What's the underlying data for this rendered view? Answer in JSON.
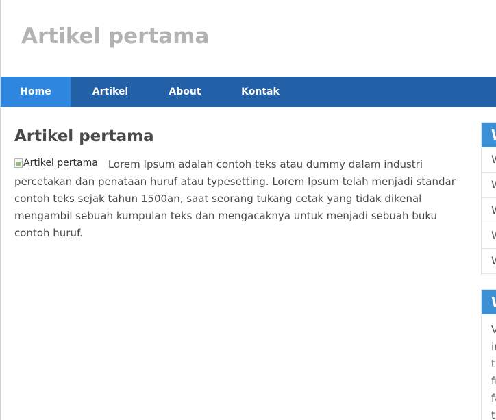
{
  "header": {
    "site_title": "Artikel pertama"
  },
  "nav": {
    "items": [
      "Home",
      "Artikel",
      "About",
      "Kontak"
    ]
  },
  "post": {
    "title": "Artikel pertama",
    "image_alt": "Artikel pertama",
    "body": "Lorem Ipsum adalah contoh teks atau dummy dalam industri percetakan dan penataan huruf atau typesetting. Lorem Ipsum telah menjadi standar contoh teks sejak tahun 1500an, saat seorang tukang cetak yang tidak dikenal mengambil sebuah kumpulan teks dan mengacaknya untuk menjadi sebuah buku contoh huruf."
  },
  "sidebar": {
    "widget1": {
      "title": "W",
      "items": [
        "W",
        "W",
        "W",
        "W",
        "W"
      ]
    },
    "widget2": {
      "title": "W",
      "lines": [
        "V",
        "ir",
        "t",
        "fr",
        "fa",
        "ti"
      ]
    }
  }
}
